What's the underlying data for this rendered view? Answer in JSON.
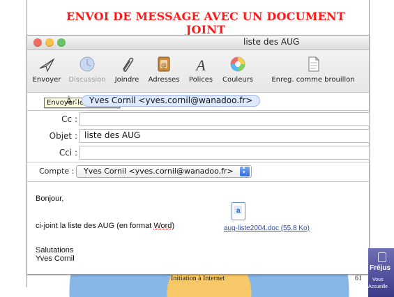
{
  "slide": {
    "title": "ENVOI DE MESSAGE AVEC UN DOCUMENT JOINT",
    "footer_text": "Initiation à Internet",
    "page_number": "61",
    "colors": {
      "title": "#ff1a1a"
    }
  },
  "window": {
    "title": "liste des AUG"
  },
  "toolbar": {
    "items": [
      {
        "label": "Envoyer",
        "icon": "send-icon",
        "enabled": true
      },
      {
        "label": "Discussion",
        "icon": "discussion-icon",
        "enabled": false
      },
      {
        "label": "Joindre",
        "icon": "paperclip-icon",
        "enabled": true
      },
      {
        "label": "Adresses",
        "icon": "address-book-icon",
        "enabled": true
      },
      {
        "label": "Polices",
        "icon": "font-icon",
        "enabled": true
      },
      {
        "label": "Couleurs",
        "icon": "color-wheel-icon",
        "enabled": true
      },
      {
        "label": "Enreg. comme brouillon",
        "icon": "draft-icon",
        "enabled": true
      }
    ],
    "tooltip": "Envoyer le message"
  },
  "fields": {
    "to_label": "À :",
    "to_value": "Yves Cornil <yves.cornil@wanadoo.fr>",
    "cc_label": "Cc :",
    "subject_label": "Objet :",
    "subject_value": "liste des AUG",
    "bcc_label": "Cci :"
  },
  "account": {
    "label": "Compte :",
    "value": "Yves Cornil <yves.cornil@wanadoo.fr>"
  },
  "message": {
    "greeting": "Bonjour,",
    "line_prefix": "ci-joint la liste des AUG (en format ",
    "line_word": "Word",
    "line_suffix": ")",
    "attachment_name": "aug-liste2004.doc (55.8 Ko)",
    "closing": "Salutations",
    "signature": "Yves Cornil"
  },
  "side_logo": {
    "text1": "Fréjus",
    "text2": "Vous",
    "text3": "Accueille"
  }
}
